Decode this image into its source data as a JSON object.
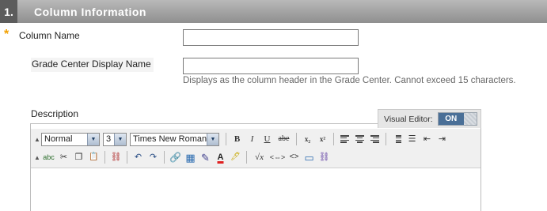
{
  "section": {
    "number": "1.",
    "title": "Column Information"
  },
  "fields": {
    "required_marker": "*",
    "column_name": {
      "label": "Column Name",
      "value": ""
    },
    "grade_center_display_name": {
      "label": "Grade Center Display Name",
      "value": "",
      "help": "Displays as the column header in the Grade Center. Cannot exceed 15 characters."
    },
    "description": {
      "label": "Description"
    }
  },
  "editor": {
    "visual_editor_label": "Visual Editor:",
    "toggle_state": "ON",
    "format_select": "Normal",
    "size_select": "3",
    "font_select": "Times New Roman",
    "glyphs": {
      "collapse": "▲",
      "dropdown": "▼",
      "bold": "B",
      "italic": "I",
      "underline": "U",
      "strike": "abe",
      "subscript": "x₂",
      "superscript": "x²",
      "numbered_list": "⅟",
      "bullet_list": "☰",
      "outdent": "⇤",
      "indent": "⇥",
      "spellcheck": "abc",
      "cut": "✂",
      "copy": "❐",
      "paste": "📋",
      "unlink": "⛓",
      "undo": "↶",
      "redo": "↷",
      "link": "🔗",
      "table": "▦",
      "pencil": "✎",
      "text_color": "A",
      "highlight": "🖊",
      "math": "√x",
      "embed": "<⇔>",
      "html": "<>",
      "fullscreen": "▭",
      "mashup": "⛓"
    },
    "colors": {
      "toggle_on": "#4a6f97",
      "text_color_underline": "#e02020",
      "highlight": "#f2e600"
    }
  }
}
